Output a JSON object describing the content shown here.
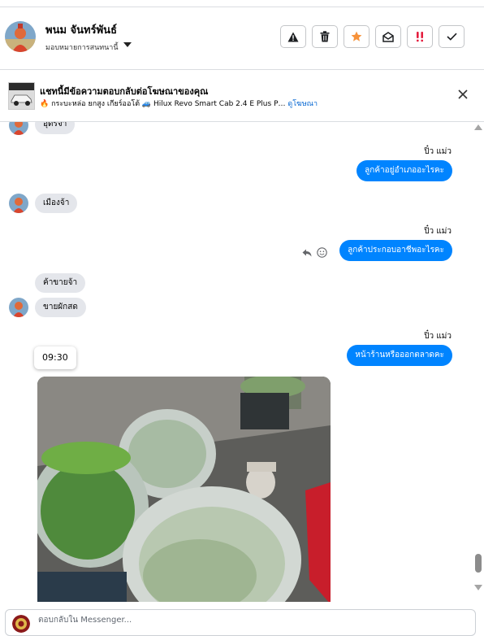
{
  "header": {
    "contact_name": "พนม จันทร์พันธ์",
    "status": "มอบหมายการสนทนานี้",
    "actions": [
      {
        "name": "report-button",
        "icon": "warning-icon"
      },
      {
        "name": "delete-button",
        "icon": "trash-icon"
      },
      {
        "name": "star-button",
        "icon": "star-icon"
      },
      {
        "name": "mark-unread-button",
        "icon": "envelope-open-icon"
      },
      {
        "name": "follow-up-button",
        "icon": "double-exclamation-icon"
      },
      {
        "name": "done-button",
        "icon": "check-icon"
      }
    ],
    "accent_star": "#f7923a",
    "accent_alert": "#e41e3f"
  },
  "ad_banner": {
    "title": "แชทนี้มีข้อความตอบกลับต่อโฆษณาของคุณ",
    "subtitle": "🔥 กระบะหล่อ ยกสูง เกียร์ออโต้ 🚙 Hilux Revo Smart Cab 2.4 E Plus P…",
    "link": "ดูโฆษณา"
  },
  "messages": {
    "m0": "อุดรจ้า",
    "sender1": "ปิ๋ว แม่ว",
    "m1": "ลูกค้าอยู่อำเภออะไรคะ",
    "m2": "เมืองจ้า",
    "sender2": "ปิ๋ว แม่ว",
    "m3": "ลูกค้าประกอบอาชีพอะไรคะ",
    "m4": "ค้าขายจ้า",
    "m5": "ขายผักสด",
    "sender3": "ปิ๋ว แม่ว",
    "m6": "หน้าร้านหรือออกตลาดคะ",
    "time_chip": "09:30"
  },
  "composer": {
    "placeholder": "ตอบกลับใน Messenger..."
  },
  "colors": {
    "outgoing_bubble": "#0084ff",
    "incoming_bubble": "#e4e6eb",
    "link": "#0064d1"
  }
}
